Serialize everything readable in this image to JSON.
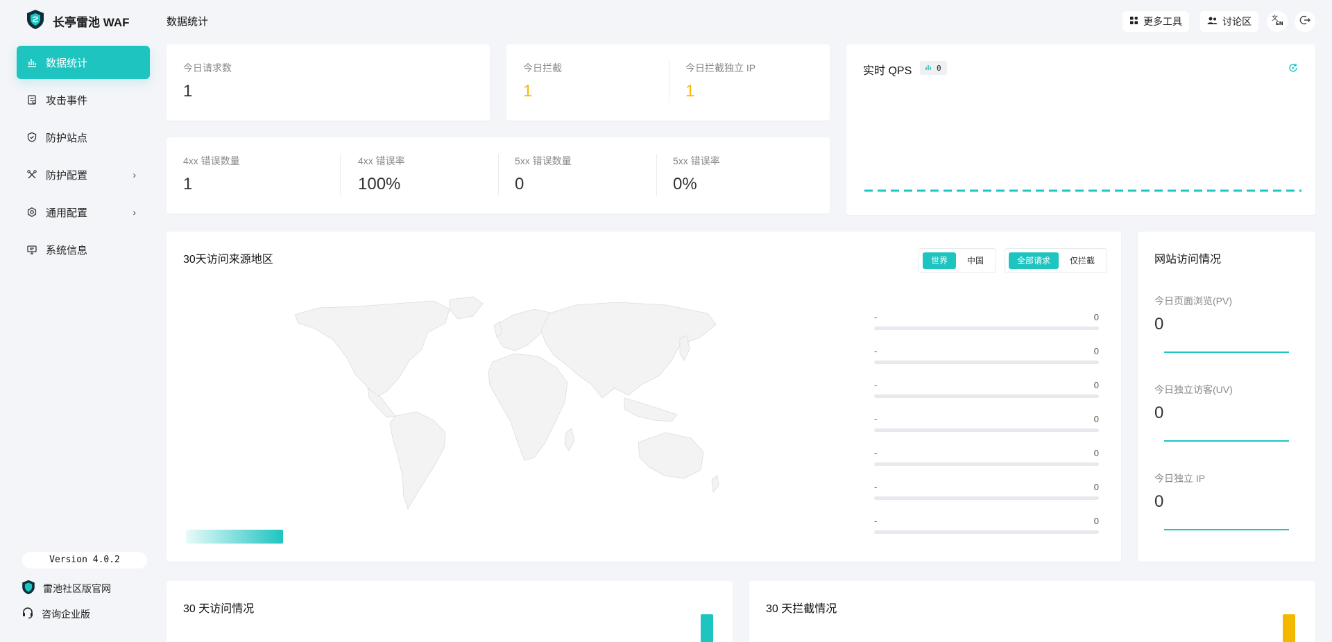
{
  "app": {
    "title": "长亭雷池 WAF"
  },
  "header": {
    "page_title": "数据统计",
    "more_tools": "更多工具",
    "forum": "讨论区"
  },
  "sidebar": {
    "items": [
      {
        "label": "数据统计",
        "icon": "bar-chart-icon",
        "active": true
      },
      {
        "label": "攻击事件",
        "icon": "event-icon"
      },
      {
        "label": "防护站点",
        "icon": "shield-icon"
      },
      {
        "label": "防护配置",
        "icon": "tools-icon",
        "expandable": true
      },
      {
        "label": "通用配置",
        "icon": "settings-icon",
        "expandable": true
      },
      {
        "label": "系统信息",
        "icon": "monitor-icon"
      }
    ],
    "version": "Version 4.0.2",
    "community_link": "雷池社区版官网",
    "enterprise_link": "咨询企业版"
  },
  "stats": {
    "today_requests": {
      "label": "今日请求数",
      "value": "1"
    },
    "today_blocked": {
      "label": "今日拦截",
      "value": "1"
    },
    "today_blocked_ip": {
      "label": "今日拦截独立 IP",
      "value": "1"
    },
    "err4xx_count": {
      "label": "4xx 错误数量",
      "value": "1"
    },
    "err4xx_rate": {
      "label": "4xx 错误率",
      "value": "100%"
    },
    "err5xx_count": {
      "label": "5xx 错误数量",
      "value": "0"
    },
    "err5xx_rate": {
      "label": "5xx 错误率",
      "value": "0%"
    }
  },
  "qps": {
    "title": "实时 QPS",
    "badge": "0"
  },
  "map_card": {
    "title": "30天访问来源地区",
    "scope_options": [
      "世界",
      "中国"
    ],
    "scope_selected": "世界",
    "filter_options": [
      "全部请求",
      "仅拦截"
    ],
    "filter_selected": "全部请求",
    "regions": [
      {
        "name": "-",
        "value": "0"
      },
      {
        "name": "-",
        "value": "0"
      },
      {
        "name": "-",
        "value": "0"
      },
      {
        "name": "-",
        "value": "0"
      },
      {
        "name": "-",
        "value": "0"
      },
      {
        "name": "-",
        "value": "0"
      },
      {
        "name": "-",
        "value": "0"
      }
    ]
  },
  "site_visits": {
    "title": "网站访问情况",
    "pv": {
      "label": "今日页面浏览(PV)",
      "value": "0"
    },
    "uv": {
      "label": "今日独立访客(UV)",
      "value": "0"
    },
    "ip": {
      "label": "今日独立 IP",
      "value": "0"
    }
  },
  "bottom": {
    "visits_title": "30 天访问情况",
    "blocked_title": "30 天拦截情况"
  },
  "colors": {
    "accent": "#1ec4c0",
    "warning": "#f5b800"
  }
}
